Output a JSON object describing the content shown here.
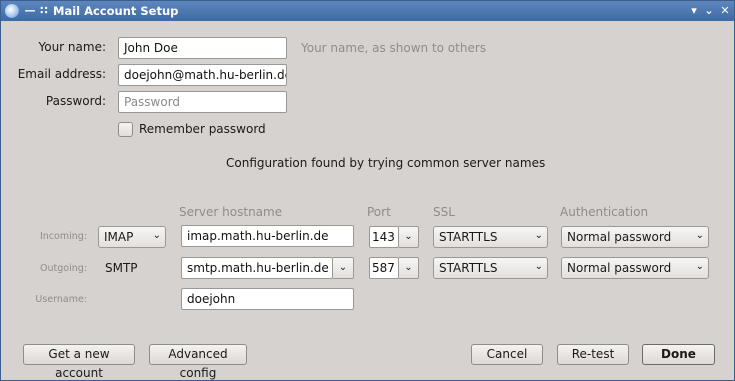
{
  "window": {
    "title": "Mail Account Setup"
  },
  "identity": {
    "name_label": "Your name:",
    "name_value": "John Doe",
    "name_hint": "Your name, as shown to others",
    "email_label": "Email address:",
    "email_value": "doejohn@math.hu-berlin.de",
    "password_label": "Password:",
    "password_placeholder": "Password",
    "remember_label": "Remember password"
  },
  "status_message": "Configuration found by trying common server names",
  "columns": {
    "hostname": "Server hostname",
    "port": "Port",
    "ssl": "SSL",
    "auth": "Authentication"
  },
  "incoming": {
    "label": "Incoming:",
    "protocol": "IMAP",
    "hostname": "imap.math.hu-berlin.de",
    "port": "143",
    "ssl": "STARTTLS",
    "auth": "Normal password"
  },
  "outgoing": {
    "label": "Outgoing:",
    "protocol": "SMTP",
    "hostname": "smtp.math.hu-berlin.de",
    "port": "587",
    "ssl": "STARTTLS",
    "auth": "Normal password"
  },
  "username": {
    "label": "Username:",
    "value": "doejohn"
  },
  "buttons": {
    "get_account": "Get a new account",
    "advanced": "Advanced config",
    "cancel": "Cancel",
    "retest": "Re-test",
    "done": "Done"
  }
}
